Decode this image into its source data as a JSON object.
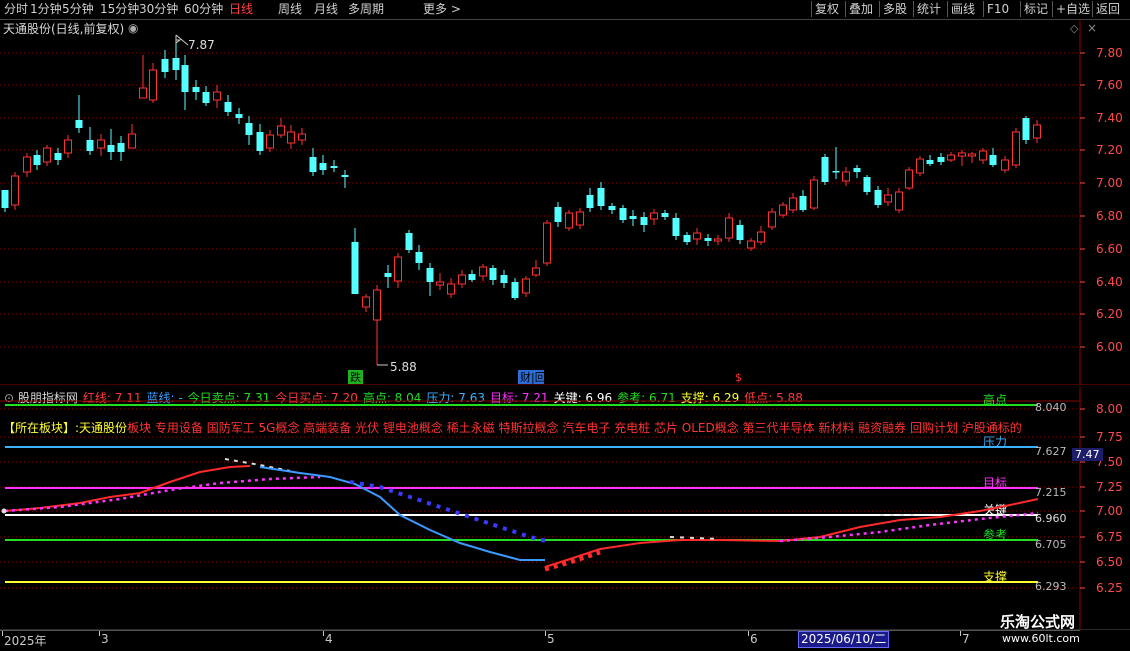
{
  "toolbar": {
    "periods": [
      "分时",
      "1分钟",
      "5分钟",
      "15分钟",
      "30分钟",
      "60分钟",
      "日线",
      "周线",
      "月线",
      "多周期",
      "更多"
    ],
    "active_period": "日线",
    "more_arrow": ">",
    "right_buttons": [
      "复权",
      "叠加",
      "多股",
      "统计",
      "画线",
      "F10",
      "标记",
      "+自选",
      "返回"
    ]
  },
  "main": {
    "title": "天通股份(日线,前复权)",
    "high_marker": "7.87",
    "low_marker": "5.88",
    "price_axis": [
      "7.80",
      "7.60",
      "7.40",
      "7.20",
      "7.00",
      "6.80",
      "6.60",
      "6.40",
      "6.20",
      "6.00"
    ],
    "event_badges": [
      {
        "text": "跌",
        "color": "#1fb41f"
      },
      {
        "text": "财|回",
        "color": "#2d6dd8"
      },
      {
        "text": "$",
        "color": "#ff3030"
      }
    ]
  },
  "indicator": {
    "name": "股朋指标网",
    "fields": [
      {
        "label": "红线:",
        "value": "7.11",
        "color": "#ff3a3a"
      },
      {
        "label": "蓝线:",
        "value": "-",
        "color": "#3aa0ff"
      },
      {
        "label": "今日卖点:",
        "value": "7.31",
        "color": "#22dd22"
      },
      {
        "label": "今日买点:",
        "value": "7.20",
        "color": "#ff3a3a"
      },
      {
        "label": "高点:",
        "value": "8.04",
        "color": "#22dd22"
      },
      {
        "label": "压力:",
        "value": "7.63",
        "color": "#3ab0ff"
      },
      {
        "label": "目标:",
        "value": "7.21",
        "color": "#ff33ff"
      },
      {
        "label": "关键:",
        "value": "6.96",
        "color": "#ffffff"
      },
      {
        "label": "参考:",
        "value": "6.71",
        "color": "#22dd22"
      },
      {
        "label": "支撑:",
        "value": "6.29",
        "color": "#ffff33"
      },
      {
        "label": "低点:",
        "value": "5.88",
        "color": "#ff3a3a"
      }
    ],
    "sector_prefix": "【所在板块】:",
    "sector_stock": "天通股份",
    "sector_list": "板块 专用设备 国防军工 5G概念 高端装备 光伏 锂电池概念 稀土永磁 特斯拉概念 汽车电子 充电桩 芯片 OLED概念 第三代半导体 新材料 融资融券 回购计划 沪股通标的",
    "line_labels": [
      {
        "text": "高点",
        "color": "#22dd22"
      },
      {
        "text": "压力",
        "color": "#3ab0ff"
      },
      {
        "text": "目标",
        "color": "#ff33ff"
      },
      {
        "text": "关键",
        "color": "#ffffff"
      },
      {
        "text": "参考",
        "color": "#22dd22"
      },
      {
        "text": "支撑",
        "color": "#ffff33"
      }
    ],
    "line_values": [
      "8.040",
      "7.627",
      "7.215",
      "6.960",
      "6.705",
      "6.293"
    ],
    "axis": [
      "8.00",
      "7.75",
      "7.50",
      "7.25",
      "7.00",
      "6.75",
      "6.50",
      "6.25"
    ],
    "current_value": "7.47"
  },
  "datebar": {
    "labels": [
      "2025年",
      "3",
      "4",
      "5",
      "6",
      "7"
    ],
    "selected": "2025/06/10/二"
  },
  "watermark": {
    "line1": "乐淘公式网",
    "line2": "www.60lt.com"
  },
  "colors": {
    "up": "#ff3232",
    "down": "#54ffff",
    "grid": "#8b0000"
  }
}
